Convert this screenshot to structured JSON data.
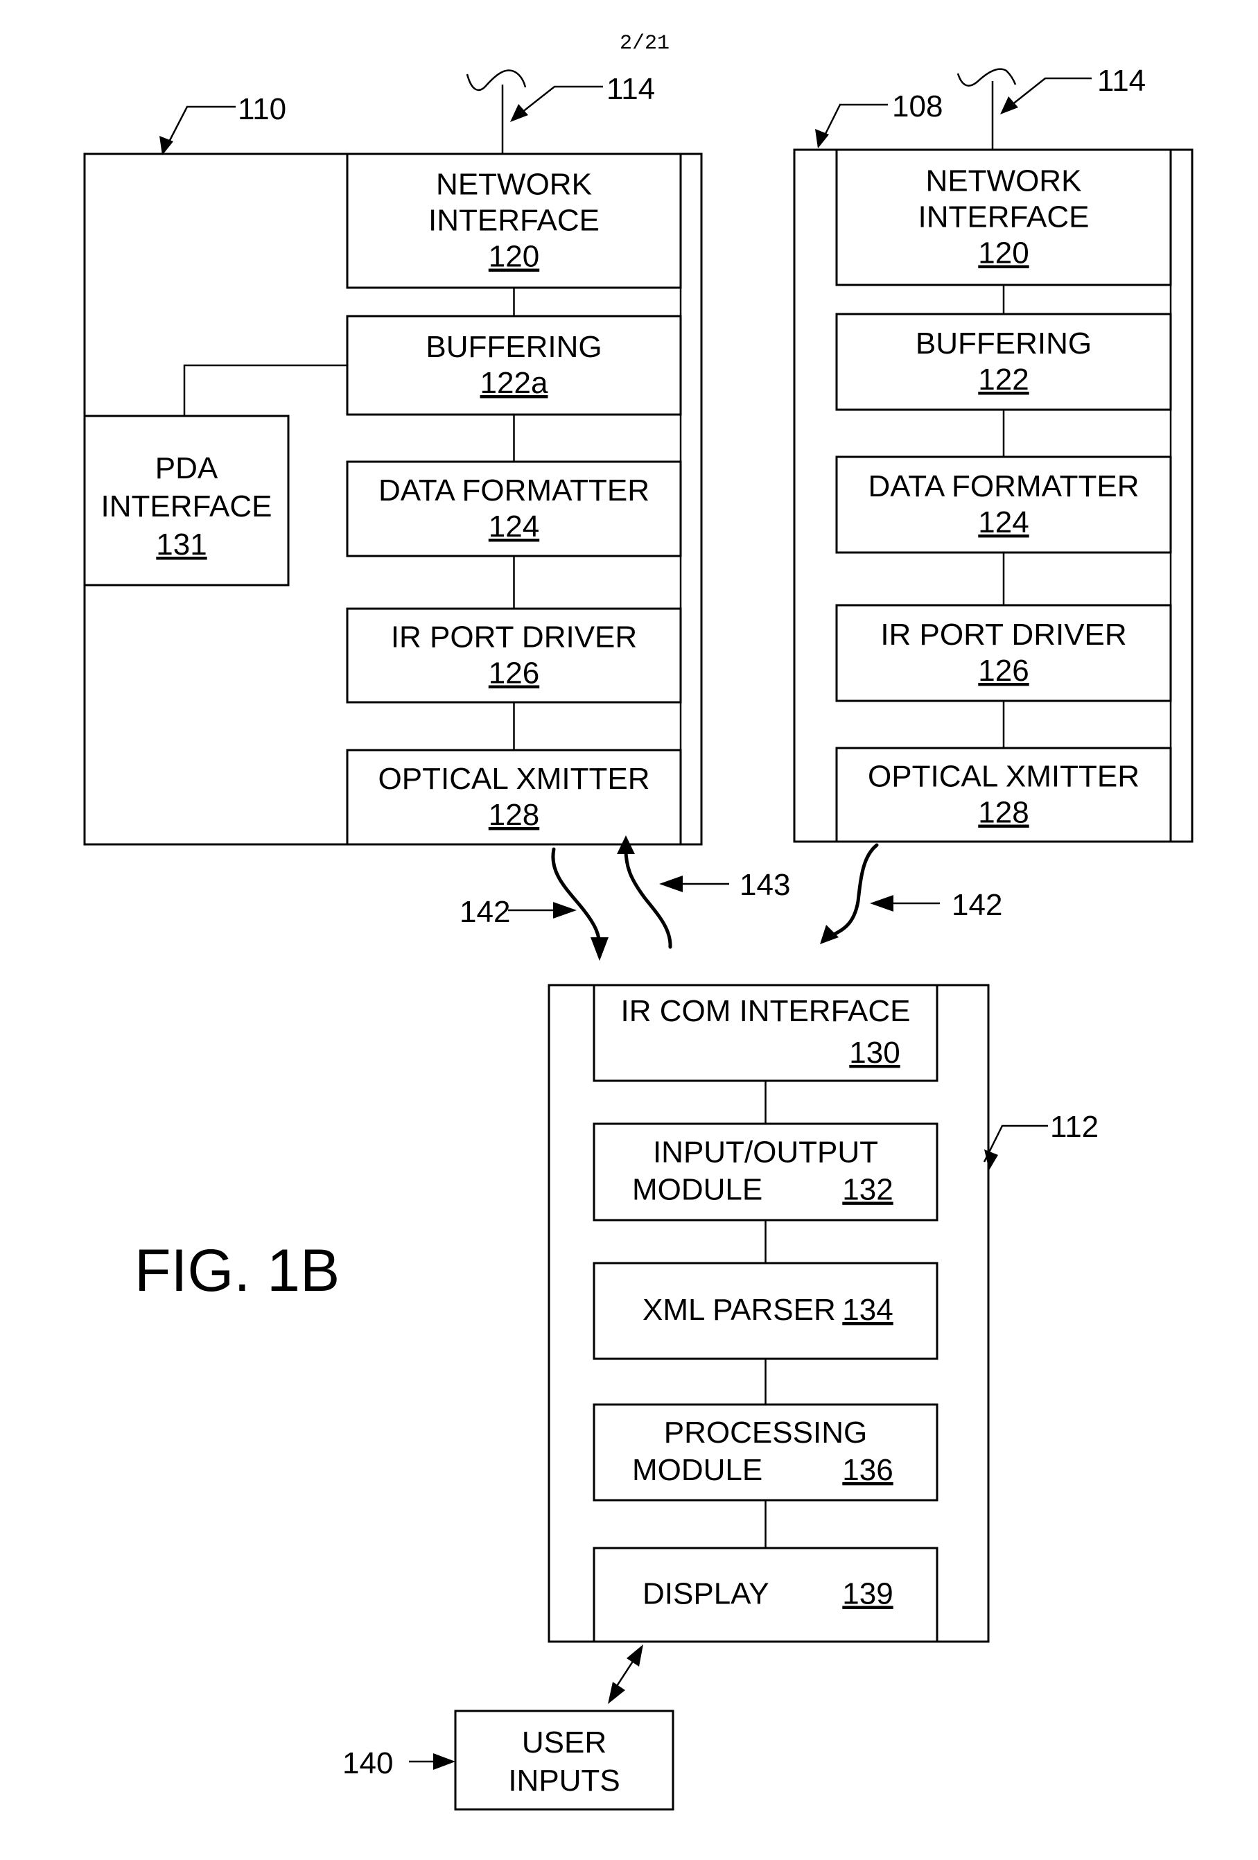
{
  "page_number": "2/21",
  "figure_label": "FIG. 1B",
  "device_110": {
    "ref": "110",
    "antenna_ref": "114",
    "blocks": [
      {
        "lines": [
          "NETWORK",
          "INTERFACE"
        ],
        "num": "120"
      },
      {
        "lines": [
          "BUFFERING"
        ],
        "num": "122a"
      },
      {
        "lines": [
          "DATA FORMATTER"
        ],
        "num": "124"
      },
      {
        "lines": [
          "IR PORT DRIVER"
        ],
        "num": "126"
      },
      {
        "lines": [
          "OPTICAL XMITTER"
        ],
        "num": "128"
      }
    ],
    "side_block": {
      "lines": [
        "PDA",
        "INTERFACE"
      ],
      "num": "131"
    }
  },
  "device_108": {
    "ref": "108",
    "antenna_ref": "114",
    "blocks": [
      {
        "lines": [
          "NETWORK",
          "INTERFACE"
        ],
        "num": "120"
      },
      {
        "lines": [
          "BUFFERING"
        ],
        "num": "122"
      },
      {
        "lines": [
          "DATA FORMATTER"
        ],
        "num": "124"
      },
      {
        "lines": [
          "IR PORT DRIVER"
        ],
        "num": "126"
      },
      {
        "lines": [
          "OPTICAL XMITTER"
        ],
        "num": "128"
      }
    ]
  },
  "device_112": {
    "ref": "112",
    "blocks": [
      {
        "lines": [
          "IR COM INTERFACE"
        ],
        "num": "130"
      },
      {
        "lines": [
          "INPUT/OUTPUT",
          "MODULE"
        ],
        "num": "132"
      },
      {
        "lines": [
          "XML PARSER"
        ],
        "num": "134"
      },
      {
        "lines": [
          "PROCESSING",
          "MODULE"
        ],
        "num": "136"
      },
      {
        "lines": [
          "DISPLAY"
        ],
        "num": "139"
      }
    ]
  },
  "user_inputs": {
    "lines": [
      "USER",
      "INPUTS"
    ],
    "ref": "140"
  },
  "signals": {
    "ir_downlink_left": "142",
    "ir_uplink": "143",
    "ir_downlink_right": "142"
  }
}
